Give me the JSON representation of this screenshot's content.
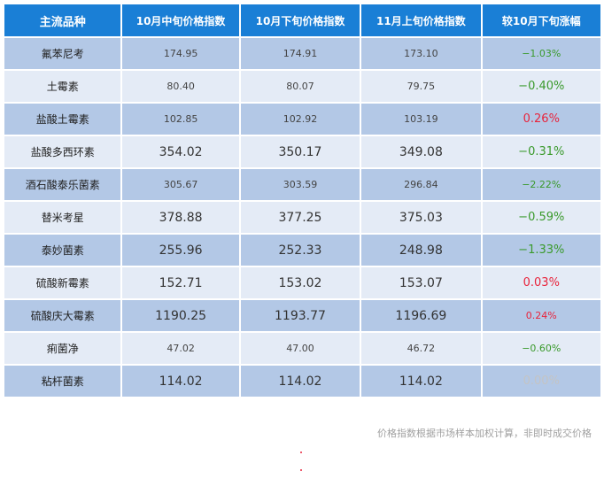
{
  "table": {
    "headers": [
      "主流品种",
      "10月中旬价格指数",
      "10月下旬价格指数",
      "11月上旬价格指数",
      "较10月下旬涨幅"
    ],
    "rows": [
      {
        "name": "氟苯尼考",
        "mid_oct": "174.95",
        "late_oct": "174.91",
        "early_nov": "173.10",
        "change": "−1.03%",
        "trend": "down",
        "size": "small"
      },
      {
        "name": "土霉素",
        "mid_oct": "80.40",
        "late_oct": "80.07",
        "early_nov": "79.75",
        "change": "−0.40%",
        "trend": "down",
        "size": "small",
        "change_size": "big"
      },
      {
        "name": "盐酸土霉素",
        "mid_oct": "102.85",
        "late_oct": "102.92",
        "early_nov": "103.19",
        "change": "0.26%",
        "trend": "up",
        "size": "small",
        "change_size": "big"
      },
      {
        "name": "盐酸多西环素",
        "mid_oct": "354.02",
        "late_oct": "350.17",
        "early_nov": "349.08",
        "change": "−0.31%",
        "trend": "down",
        "size": "big",
        "change_size": "big"
      },
      {
        "name": "酒石酸泰乐菌素",
        "mid_oct": "305.67",
        "late_oct": "303.59",
        "early_nov": "296.84",
        "change": "−2.22%",
        "trend": "down",
        "size": "small"
      },
      {
        "name": "替米考星",
        "mid_oct": "378.88",
        "late_oct": "377.25",
        "early_nov": "375.03",
        "change": "−0.59%",
        "trend": "down",
        "size": "big",
        "change_size": "big"
      },
      {
        "name": "泰妙菌素",
        "mid_oct": "255.96",
        "late_oct": "252.33",
        "early_nov": "248.98",
        "change": "−1.33%",
        "trend": "down",
        "size": "big",
        "change_size": "big"
      },
      {
        "name": "硫酸新霉素",
        "mid_oct": "152.71",
        "late_oct": "153.02",
        "early_nov": "153.07",
        "change": "0.03%",
        "trend": "up",
        "size": "big",
        "change_size": "big"
      },
      {
        "name": "硫酸庆大霉素",
        "mid_oct": "1190.25",
        "late_oct": "1193.77",
        "early_nov": "1196.69",
        "change": "0.24%",
        "trend": "up",
        "size": "big"
      },
      {
        "name": "痢菌净",
        "mid_oct": "47.02",
        "late_oct": "47.00",
        "early_nov": "46.72",
        "change": "−0.60%",
        "trend": "down",
        "size": "small"
      },
      {
        "name": "粘杆菌素",
        "mid_oct": "114.02",
        "late_oct": "114.02",
        "early_nov": "114.02",
        "change": "0.00%",
        "trend": "flat",
        "size": "big",
        "change_size": "big"
      }
    ]
  },
  "note": "价格指数根据市场样本加权计算，非即时成交价格",
  "colors": {
    "header_bg": "#1a7fd6",
    "row_odd": "#b3c8e6",
    "row_even": "#e4ebf6",
    "up": "#e8243c",
    "down": "#3a9a2c",
    "flat": "#c4c4c4"
  }
}
